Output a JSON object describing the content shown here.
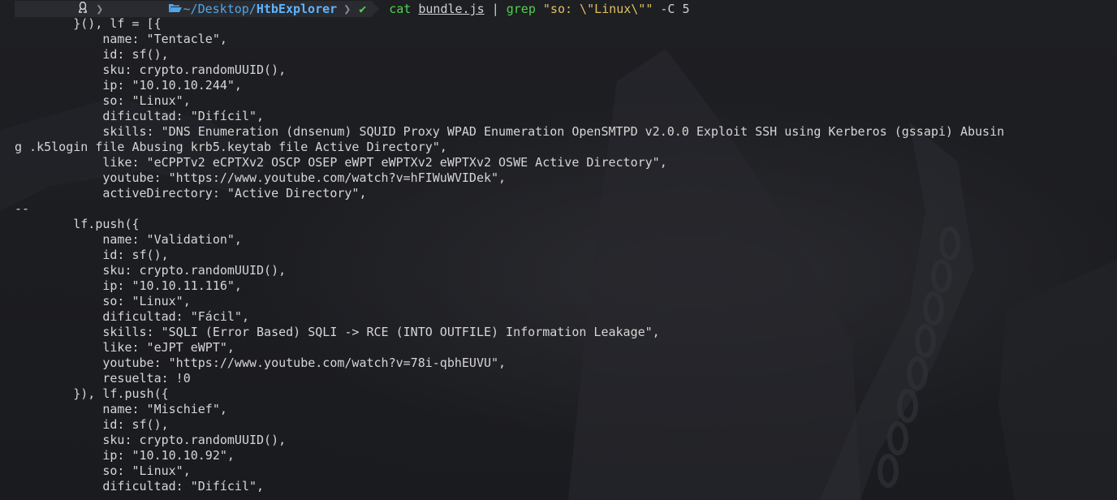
{
  "prompt": {
    "os_icon": "linux-tux-icon",
    "folder_icon": "folder-open-icon",
    "path_prefix": "~/Desktop/",
    "path_current": "HtbExplorer",
    "status_icon": "checkmark-icon",
    "status_glyph": "✔",
    "command": {
      "cmd": "cat",
      "file": "bundle.js",
      "pipe": "|",
      "grep": "grep",
      "pattern": "\"so: \\\"Linux\\\"\"",
      "flags": "-C 5"
    }
  },
  "output_lines": [
    "        }(), lf = [{",
    "            name: \"Tentacle\",",
    "            id: sf(),",
    "            sku: crypto.randomUUID(),",
    "            ip: \"10.10.10.244\",",
    "            so: \"Linux\",",
    "            dificultad: \"Difícil\",",
    "            skills: \"DNS Enumeration (dnsenum) SQUID Proxy WPAD Enumeration OpenSMTPD v2.0.0 Exploit SSH using Kerberos (gssapi) Abusin",
    "g .k5login file Abusing krb5.keytab file Active Directory\",",
    "            like: \"eCPPTv2 eCPTXv2 OSCP OSEP eWPT eWPTXv2 eWPTXv2 OSWE Active Directory\",",
    "            youtube: \"https://www.youtube.com/watch?v=hFIWuWVIDek\",",
    "            activeDirectory: \"Active Directory\",",
    "--",
    "        lf.push({",
    "            name: \"Validation\",",
    "            id: sf(),",
    "            sku: crypto.randomUUID(),",
    "            ip: \"10.10.11.116\",",
    "            so: \"Linux\",",
    "            dificultad: \"Fácil\",",
    "            skills: \"SQLI (Error Based) SQLI -> RCE (INTO OUTFILE) Information Leakage\",",
    "            like: \"eJPT eWPT\",",
    "            youtube: \"https://www.youtube.com/watch?v=78i-qbhEUVU\",",
    "            resuelta: !0",
    "        }), lf.push({",
    "            name: \"Mischief\",",
    "            id: sf(),",
    "            sku: crypto.randomUUID(),",
    "            ip: \"10.10.10.92\",",
    "            so: \"Linux\",",
    "            dificultad: \"Difícil\","
  ]
}
